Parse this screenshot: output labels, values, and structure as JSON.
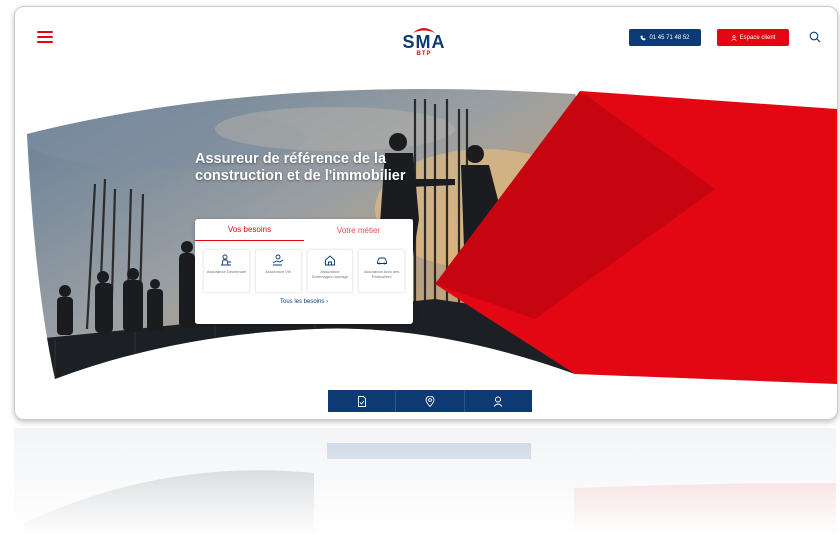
{
  "header": {
    "logo_text": "SMA",
    "logo_sub": "BTP",
    "phone_label": "01 45 71 48 52",
    "client_label": "Espace client"
  },
  "hero": {
    "headline": "Assureur de référence de la construction et de l'immobilier"
  },
  "needs_card": {
    "tabs": [
      {
        "label": "Vos besoins",
        "active": true
      },
      {
        "label": "Votre métier",
        "active": false
      }
    ],
    "tiles": [
      {
        "label": "Assurance Décennale",
        "icon": "worker-icon"
      },
      {
        "label": "Assurance Vie",
        "icon": "hand-coin-icon"
      },
      {
        "label": "Assurance Dommages-ouvrage",
        "icon": "house-icon"
      },
      {
        "label": "Assurance Auto des Particuliers",
        "icon": "car-icon"
      }
    ],
    "all_needs_label": "Tous les besoins ›"
  },
  "bottom_bar": {
    "items": [
      {
        "icon": "quote-document-icon"
      },
      {
        "icon": "location-pin-icon"
      },
      {
        "icon": "advisor-icon"
      }
    ]
  },
  "colors": {
    "brand_red": "#e30613",
    "brand_navy": "#0d3a72"
  }
}
